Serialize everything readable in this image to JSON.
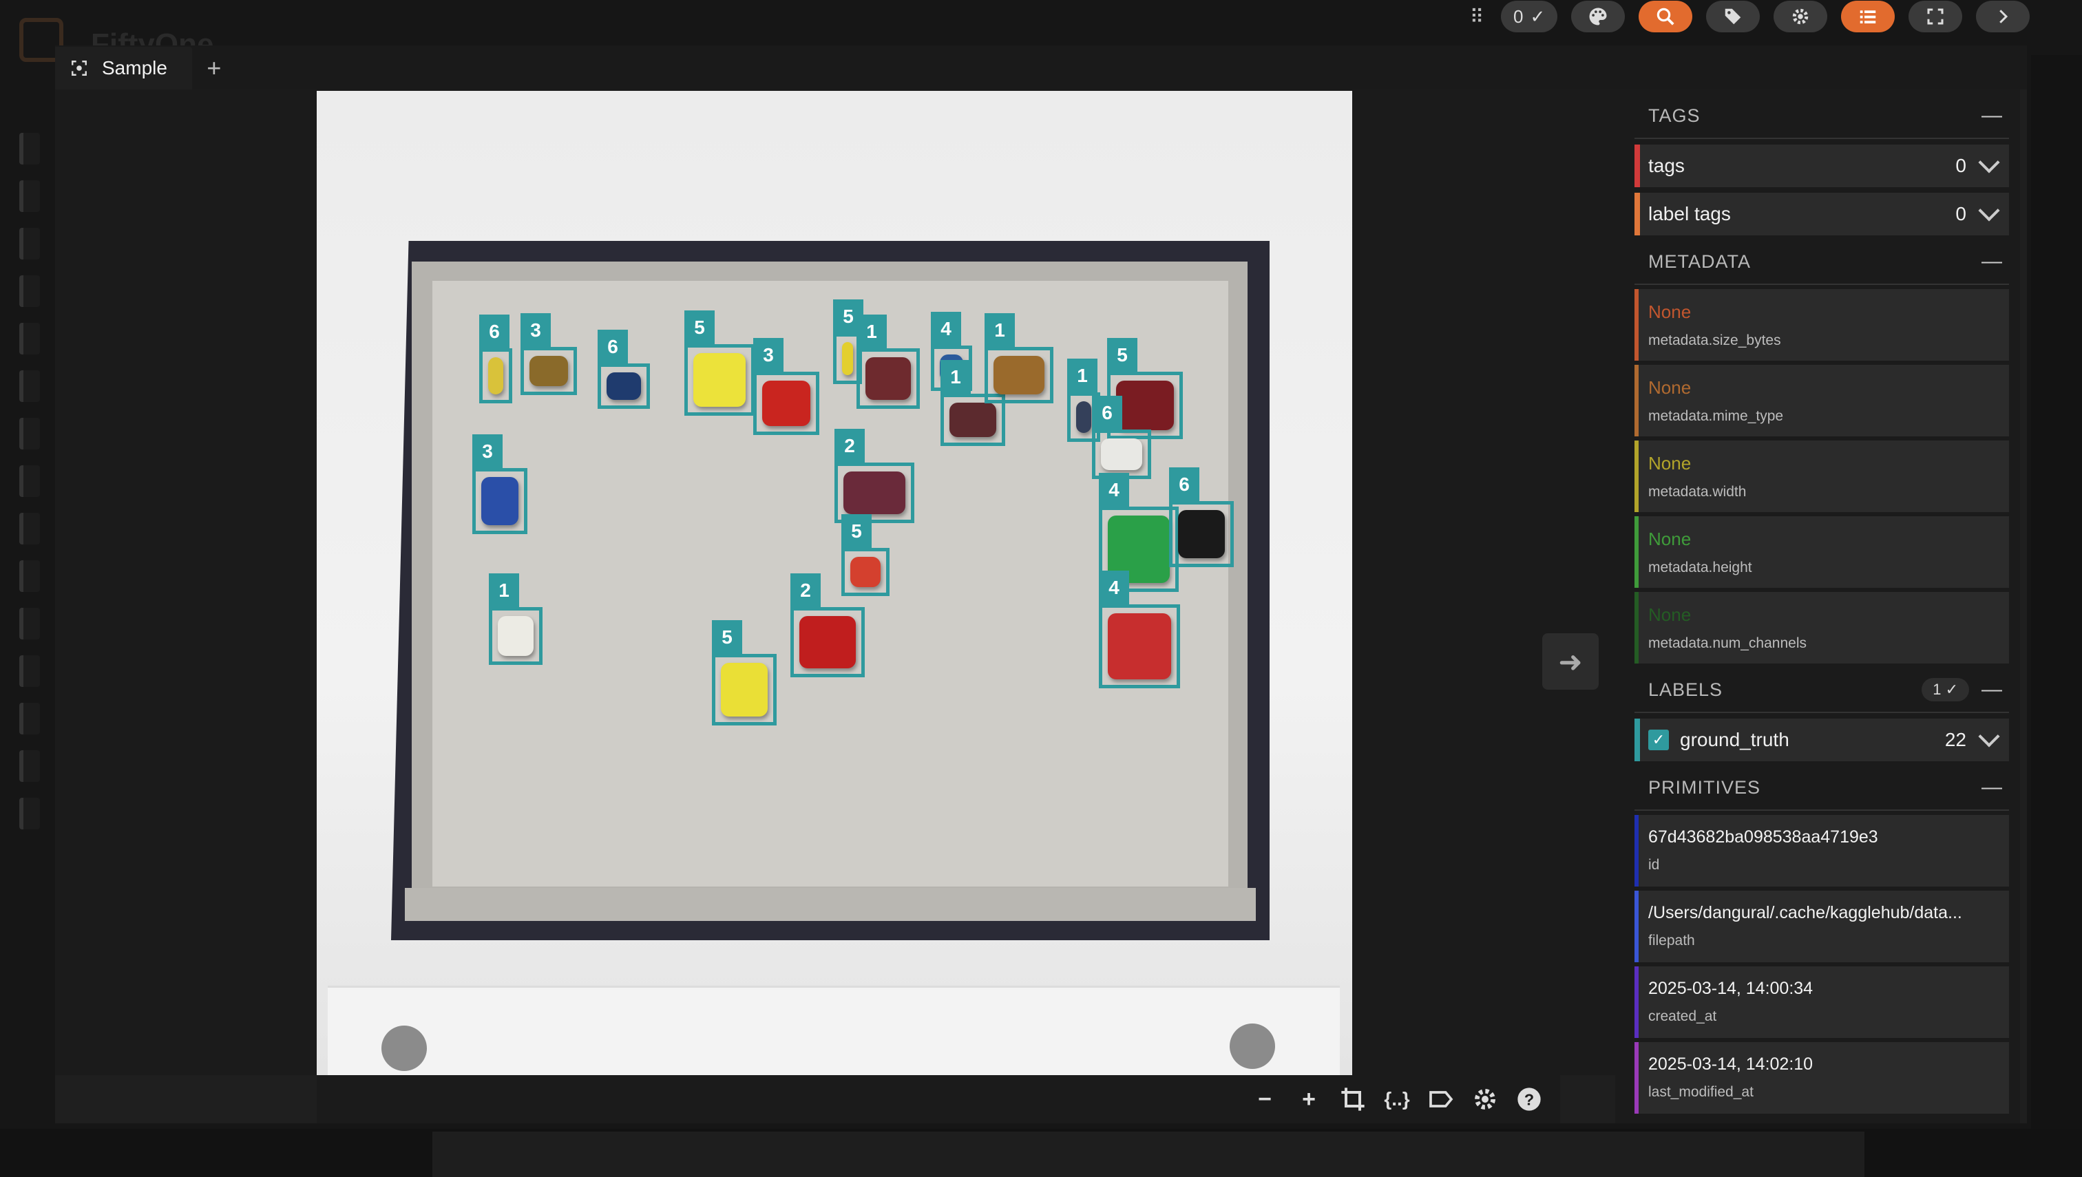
{
  "app": {
    "background_title": "FiftyOne"
  },
  "toolbar": {
    "selected_count": "0",
    "icons": [
      "grip-icon",
      "check-icon",
      "palette-icon",
      "search-icon",
      "tag-icon",
      "gear-icon",
      "list-icon",
      "fullscreen-icon",
      "chevron-right-icon"
    ]
  },
  "modal": {
    "tab_label": "Sample",
    "add_tab": "+"
  },
  "detections": [
    {
      "label": "6",
      "color": "#d9c23a"
    },
    {
      "label": "3",
      "color": "#8a6a2a"
    },
    {
      "label": "6",
      "color": "#1f3b6e"
    },
    {
      "label": "5",
      "color": "#ece23a"
    },
    {
      "label": "3",
      "color": "#c9251f"
    },
    {
      "label": "5",
      "color": "#e3cf2e"
    },
    {
      "label": "1",
      "color": "#6e2a2e"
    },
    {
      "label": "4",
      "color": "#2c5b9c"
    },
    {
      "label": "1",
      "color": "#5c2a2e"
    },
    {
      "label": "1",
      "color": "#9a6a2c"
    },
    {
      "label": "1",
      "color": "#34405a"
    },
    {
      "label": "5",
      "color": "#7a1c22"
    },
    {
      "label": "6",
      "color": "#e8e8e4"
    },
    {
      "label": "2",
      "color": "#6a2a3a"
    },
    {
      "label": "3",
      "color": "#2a4fa8"
    },
    {
      "label": "4",
      "color": "#2aa048"
    },
    {
      "label": "6",
      "color": "#1a1a1a"
    },
    {
      "label": "1",
      "color": "#ecebe4"
    },
    {
      "label": "5",
      "color": "#d4402e"
    },
    {
      "label": "2",
      "color": "#c01e1e"
    },
    {
      "label": "4",
      "color": "#c72e2e"
    },
    {
      "label": "5",
      "color": "#eadf36"
    }
  ],
  "sidebar": {
    "tags": {
      "title": "TAGS",
      "rows": [
        {
          "label": "tags",
          "count": "0",
          "color": "#d13a3a"
        },
        {
          "label": "label tags",
          "count": "0",
          "color": "#e0773a"
        }
      ]
    },
    "metadata": {
      "title": "METADATA",
      "rows": [
        {
          "value": "None",
          "key": "metadata.size_bytes",
          "color": "#c2562e"
        },
        {
          "value": "None",
          "key": "metadata.mime_type",
          "color": "#b06a30"
        },
        {
          "value": "None",
          "key": "metadata.width",
          "color": "#b2a42a"
        },
        {
          "value": "None",
          "key": "metadata.height",
          "color": "#3f9b3a"
        },
        {
          "value": "None",
          "key": "metadata.num_channels",
          "color": "#245c24"
        }
      ]
    },
    "labels": {
      "title": "LABELS",
      "badge": "1",
      "rows": [
        {
          "label": "ground_truth",
          "count": "22",
          "color": "#2f9a9e"
        }
      ]
    },
    "primitives": {
      "title": "PRIMITIVES",
      "rows": [
        {
          "value": "67d43682ba098538aa4719e3",
          "key": "id",
          "color": "#1f2fb0"
        },
        {
          "value": "/Users/dangural/.cache/kagglehub/data...",
          "key": "filepath",
          "color": "#3a56d6"
        },
        {
          "value": "2025-03-14, 14:00:34",
          "key": "created_at",
          "color": "#5a2ec0"
        },
        {
          "value": "2025-03-14, 14:02:10",
          "key": "last_modified_at",
          "color": "#9a3ab8"
        }
      ]
    }
  },
  "bottom_bar": {
    "zoom_out": "−",
    "zoom_in": "+",
    "json": "{..}"
  }
}
